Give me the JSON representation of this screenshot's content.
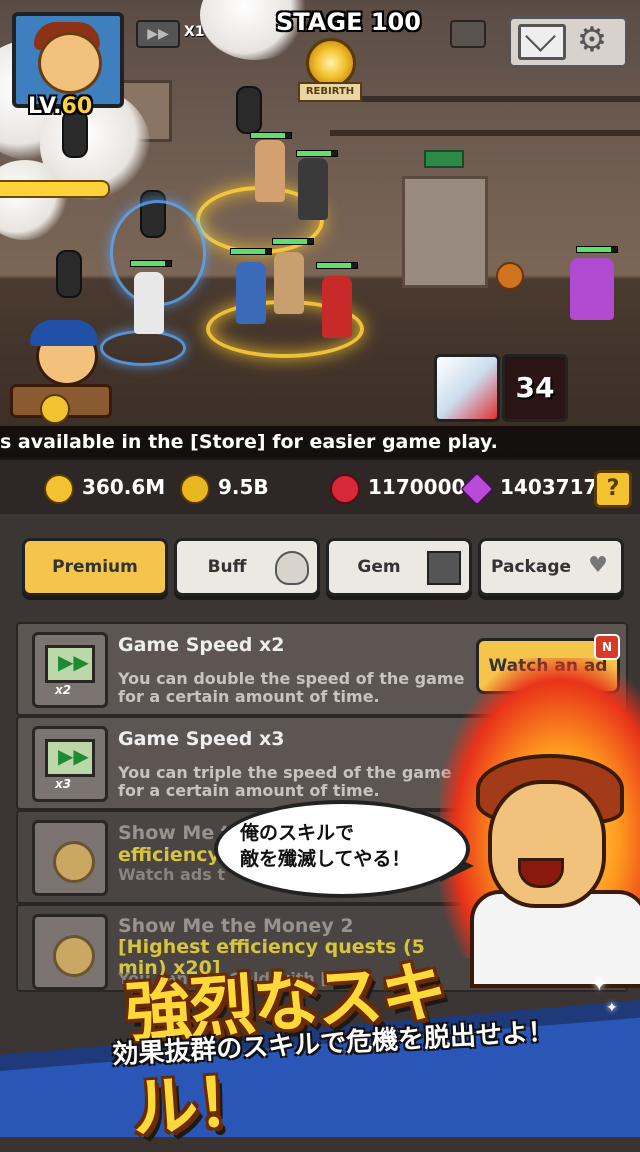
{
  "hud": {
    "level_label": "LV.",
    "level_value": "60",
    "speed_multiplier": "X1",
    "stage_label": "STAGE",
    "stage_value": "100",
    "rebirth_label": "REBIRTH",
    "skill_counter": "34",
    "ticker": "s available in the [Store] for easier game play.",
    "icons": [
      "fast-forward-icon",
      "pause-icon",
      "mail-icon",
      "gear-icon",
      "rebirth-bell-icon"
    ]
  },
  "resources": {
    "gold": "360.6M",
    "medal": "9.5B",
    "ruby": "1170000",
    "gem": "1403717",
    "help_label": "?",
    "colors": {
      "gold": "#f2c230",
      "medal": "#e8b820",
      "ruby": "#d8283a",
      "gem": "#b84ad8"
    }
  },
  "tabs": [
    {
      "label": "Premium",
      "icon": "gem-icon",
      "active": true
    },
    {
      "label": "Buff",
      "icon": "potion-icon",
      "active": false
    },
    {
      "label": "Gem",
      "icon": "gift-box-icon",
      "active": false
    },
    {
      "label": "Package",
      "icon": "wings-heart-icon",
      "active": false
    }
  ],
  "items": [
    {
      "title": "Game Speed x2",
      "desc": "You can double the speed of the game for a certain amount of time.",
      "icon_mult": "x2",
      "button": "Watch an ad",
      "badge": "N"
    },
    {
      "title": "Game Speed x3",
      "desc": "You can triple the speed of the game for a certain amount of time.",
      "icon_mult": "x3"
    },
    {
      "title": "Show Me t",
      "title_hl": "efficiency",
      "desc": "Watch ads t"
    },
    {
      "title": "Show Me the Money 2 ",
      "title_hl": "[Highest efficiency quests (5 min) x20]",
      "desc": "You can get Gold with [1"
    }
  ],
  "promo": {
    "bubble_line1": "俺のスキルで",
    "bubble_line2": "敵を殲滅してやる！",
    "headline": "強烈なスキル！",
    "subline": "効果抜群のスキルで危機を脱出せよ！",
    "accent_color": "#ffd93a"
  }
}
